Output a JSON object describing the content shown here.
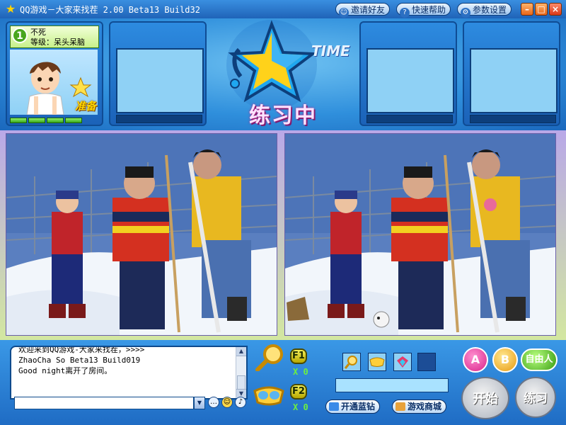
{
  "window": {
    "title": "QQ游戏－大家来找茬 2.00 Beta13 Build32",
    "buttons": {
      "invite": "邀请好友",
      "help": "快速帮助",
      "settings": "参数设置"
    }
  },
  "player": {
    "seat_number": "1",
    "name": "不死",
    "level": "等级：呆头呆脑",
    "ready_badge": "准备",
    "hp_segments": 4
  },
  "status": {
    "logo_word": "TIME",
    "state": "练习中"
  },
  "chat": {
    "lines": [
      {
        "text": "欢迎来到QQ游戏-大家来找茬，",
        "link": "",
        "suffix": ">>>>"
      },
      {
        "text": "ZhaoCha So Beta13 Build019",
        "link": "",
        "suffix": ""
      },
      {
        "text": "Good night离开了房间。",
        "link": "",
        "suffix": ""
      }
    ],
    "input_value": ""
  },
  "props": {
    "f1_key": "F1",
    "f1_count": "X 0",
    "f2_key": "F2",
    "f2_count": "X 0"
  },
  "shop": {
    "blue_diamond": "开通蓝钻",
    "game_store": "游戏商城"
  },
  "actions": {
    "a_button": "A",
    "b_button": "B",
    "free_button": "自由人",
    "start_button": "开始",
    "practice_button": "练习"
  },
  "colors": {
    "accent": "#1f6cc4",
    "status_text": "#ffe3ff",
    "counter": "#6cf040"
  }
}
